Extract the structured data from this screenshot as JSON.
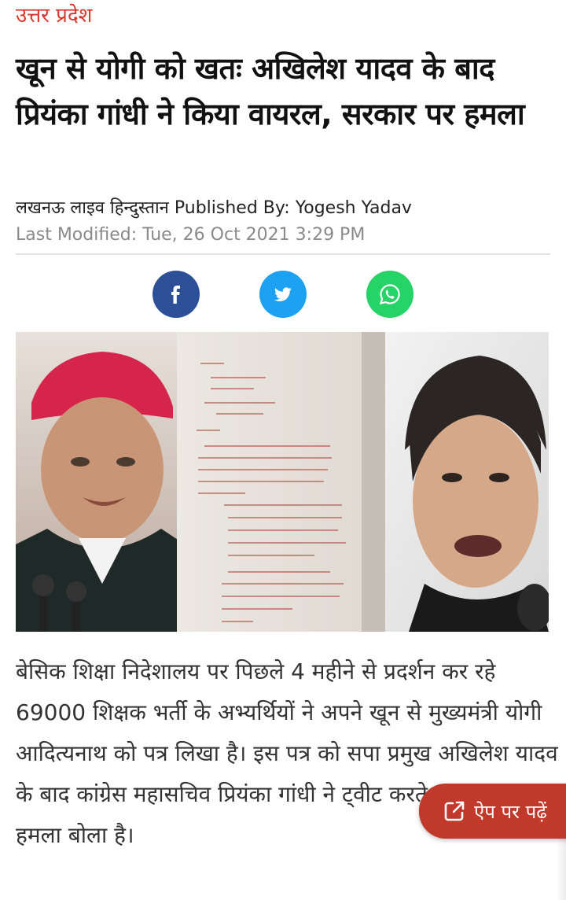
{
  "article": {
    "category": "उत्तर प्रदेश",
    "headline": "खून से योगी को खतः अखिलेश यादव के बाद प्रियंका गांधी ने किया वायरल, सरकार पर हमला",
    "byline": "लखनऊ लाइव हिन्दुस्तान Published By: Yogesh Yadav",
    "last_modified": "Last Modified: Tue, 26 Oct 2021 3:29 PM",
    "body": "बेसिक शिक्षा निदेशालय पर पिछले 4 महीने से प्रदर्शन कर रहे 69000 शिक्षक भर्ती के अभ्यर्थियों ने अपने खून से मुख्यमंत्री योगी आदित्यनाथ को पत्र लिखा है। इस पत्र को सपा प्रमुख अखिलेश यादव के बाद कांग्रेस महासचिव प्रियंका गांधी ने ट्वीट करते हुए सरकार पर हमला बोला है।"
  },
  "share": [
    {
      "icon": "facebook-icon",
      "color": "#2d4f98"
    },
    {
      "icon": "twitter-icon",
      "color": "#1da1f2"
    },
    {
      "icon": "whatsapp-icon",
      "color": "#25d366"
    }
  ],
  "app_button": {
    "label": "ऐप पर पढ़ें",
    "icon": "external-link-icon",
    "color": "#c0392b"
  }
}
